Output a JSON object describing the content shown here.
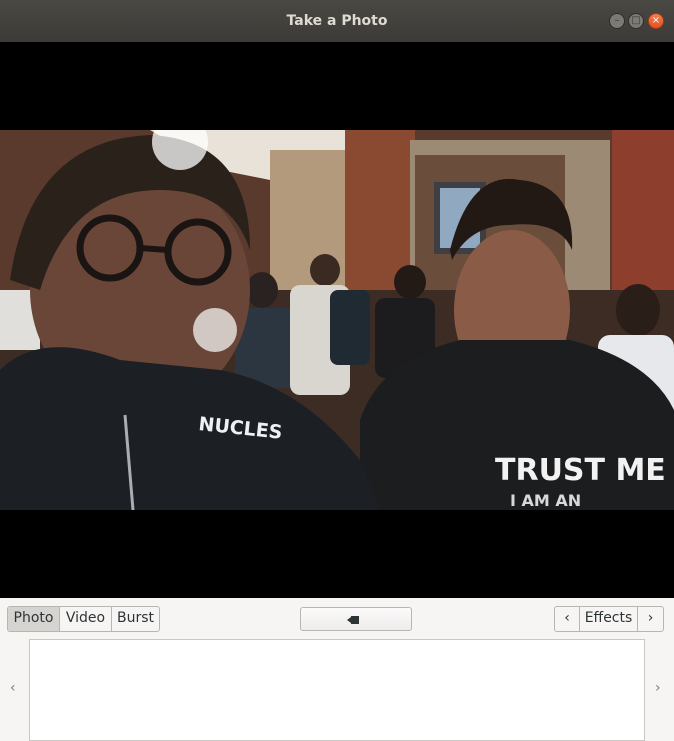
{
  "window": {
    "title": "Take a Photo"
  },
  "modes": {
    "photo": "Photo",
    "video": "Video",
    "burst": "Burst"
  },
  "effects": {
    "label": "Effects",
    "prev": "‹",
    "next": "›"
  },
  "gallery": {
    "prev": "‹",
    "next": "›"
  },
  "shirts": {
    "left": "NUCLES",
    "right_line1": "TRUST ME",
    "right_line2": "I AM AN"
  },
  "colors": {
    "titlebar": "#3c3b37",
    "close": "#e95420"
  }
}
